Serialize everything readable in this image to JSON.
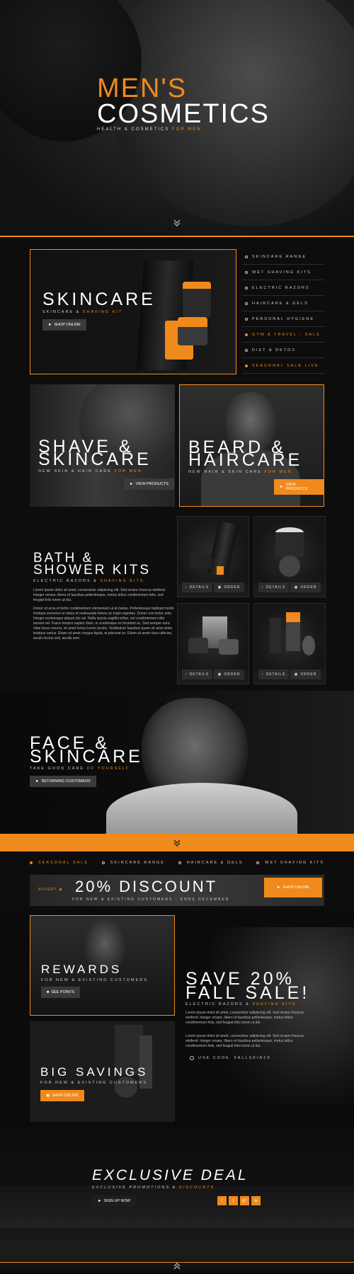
{
  "hero": {
    "title_line1": "MEN'S",
    "title_line2": "COSMETICS",
    "subtitle_main": "HEALTH & COSMETICS",
    "subtitle_accent": "FOR MEN"
  },
  "skincare_feature": {
    "title": "SKINCARE",
    "subtitle_main": "SKINCARE &",
    "subtitle_accent": "SHAVING KIT",
    "button": "SHOP ONLINE"
  },
  "category_menu": [
    {
      "label": "SKINCARE RANGE",
      "active": false
    },
    {
      "label": "WET SHAVING KITS",
      "active": false
    },
    {
      "label": "ELECTRIC RAZORS",
      "active": false
    },
    {
      "label": "HAIRCARE & GELS",
      "active": false
    },
    {
      "label": "PERSONAL HYGIENE",
      "active": false
    },
    {
      "label": "GYM & TRAVEL - SALE",
      "active": true
    },
    {
      "label": "DIET & DETOX",
      "active": false
    },
    {
      "label": "SEASONAL SALE LIVE",
      "active": true
    }
  ],
  "shave_card": {
    "title_line1": "SHAVE &",
    "title_line2": "SKINCARE",
    "subtitle_main": "NEW SKIN & HAIR CARE",
    "subtitle_accent": "FOR MEN",
    "button": "VIEW PRODUCTS"
  },
  "beard_card": {
    "title_line1": "BEARD &",
    "title_line2": "HAIRCARE",
    "subtitle_main": "NEW HAIR & SKIN CARE",
    "subtitle_accent": "FOR MEN",
    "button": "VIEW PRODUCTS"
  },
  "bath_kits": {
    "title_line1": "BATH &",
    "title_line2": "SHOWER KITS",
    "subtitle_main": "ELECTRIC RAZORS &",
    "subtitle_accent": "SHAVING KITS",
    "paragraph1": "Lorem ipsum dolor sit amet, consectetur adipiscing elit. Sed ornare rhoncus eleifend. Integer ornare, libero et faucibus pellentesque, metus tellus condimentum felis, sed feugiat felis lorem ut dui.",
    "paragraph2": "Donec et urna et tortor condimentum elementum ut at metus. Pellentesque habitant morbi tristique senectus et netus et malesuada fames ac turpis egestas. Donec non tortor ante. Integer scelerisque aliquet dui vel. Nulla lacinia sagittis tellus, vel condimentum odio laoreet vel. Fusce tempor sapien diam, in scelerisque ex tincidunt ac. Sed semper nunc vitae lacus viverra, sit amet luctus lorem iaculis. Vestibulum faucibus quam sit amet dolor tristique varius. Etiam sit amet congue ligula, et placerat ex. Etiam sit amet risus ultricies, iaculis lectus sed, iaculis sem."
  },
  "product_actions": {
    "details": "DETAILS",
    "order": "ORDER"
  },
  "face_section": {
    "title_line1": "FACE &",
    "title_line2": "SKINCARE",
    "subtitle_main": "TAKE GOOD CARE",
    "subtitle_accent": "OF YOURSELF",
    "button": "RETURNING CUSTOMERS"
  },
  "tabs": [
    {
      "label": "SEASONAL SALE",
      "active": true
    },
    {
      "label": "SKINCARE RANGE",
      "active": false
    },
    {
      "label": "HAIRCARE & GELS",
      "active": false
    },
    {
      "label": "WET SHAVING KITS",
      "active": false
    }
  ],
  "discount": {
    "advert_label": "ADVERT",
    "title": "20% DISCOUNT",
    "subtitle": "FOR NEW & EXISTING CUSTOMERS - ENDS DECEMBER",
    "button": "SHOP ONLINE"
  },
  "rewards": {
    "title": "REWARDS",
    "subtitle": "FOR NEW & EXISTING CUSTOMERS",
    "button": "SEE POINTS"
  },
  "big_savings": {
    "title": "BIG SAVINGS",
    "subtitle": "FOR NEW & EXISTING CUSTOMERS",
    "button": "SHOP ONLINE"
  },
  "fall_sale": {
    "title_line1": "SAVE 20%",
    "title_line2": "FALL SALE!",
    "subtitle_main": "ELECTRIC RAZORS &",
    "subtitle_accent": "SHAVING KITS",
    "paragraph1": "Lorem ipsum dolor sit amet, consectetur adipiscing elit. Sed ornare rhoncus eleifend. Integer ornare, libero et faucibus pellentesque, metus tellus condimentum felis, sed feugiat felis lorem ut dui.",
    "paragraph2": "Lorem ipsum dolor sit amet, consectetur adipiscing elit. Sed ornare rhoncus eleifend. Integer ornare, libero et faucibus pellentesque, metus tellus condimentum felis, sed feugiat felis lorem ut dui.",
    "code_prefix": "USE CODE",
    "code": "FALLSKIN19"
  },
  "exclusive": {
    "title": "EXCLUSIVE DEAL",
    "subtitle_main": "EXCLUSIVE PROMOTIONS &",
    "subtitle_accent": "DISCOUNTS",
    "button": "SIGN UP NOW",
    "social": [
      "f",
      "t",
      "g+",
      "w"
    ]
  },
  "colors": {
    "accent": "#f08a1c",
    "background": "#0d0d0d"
  }
}
